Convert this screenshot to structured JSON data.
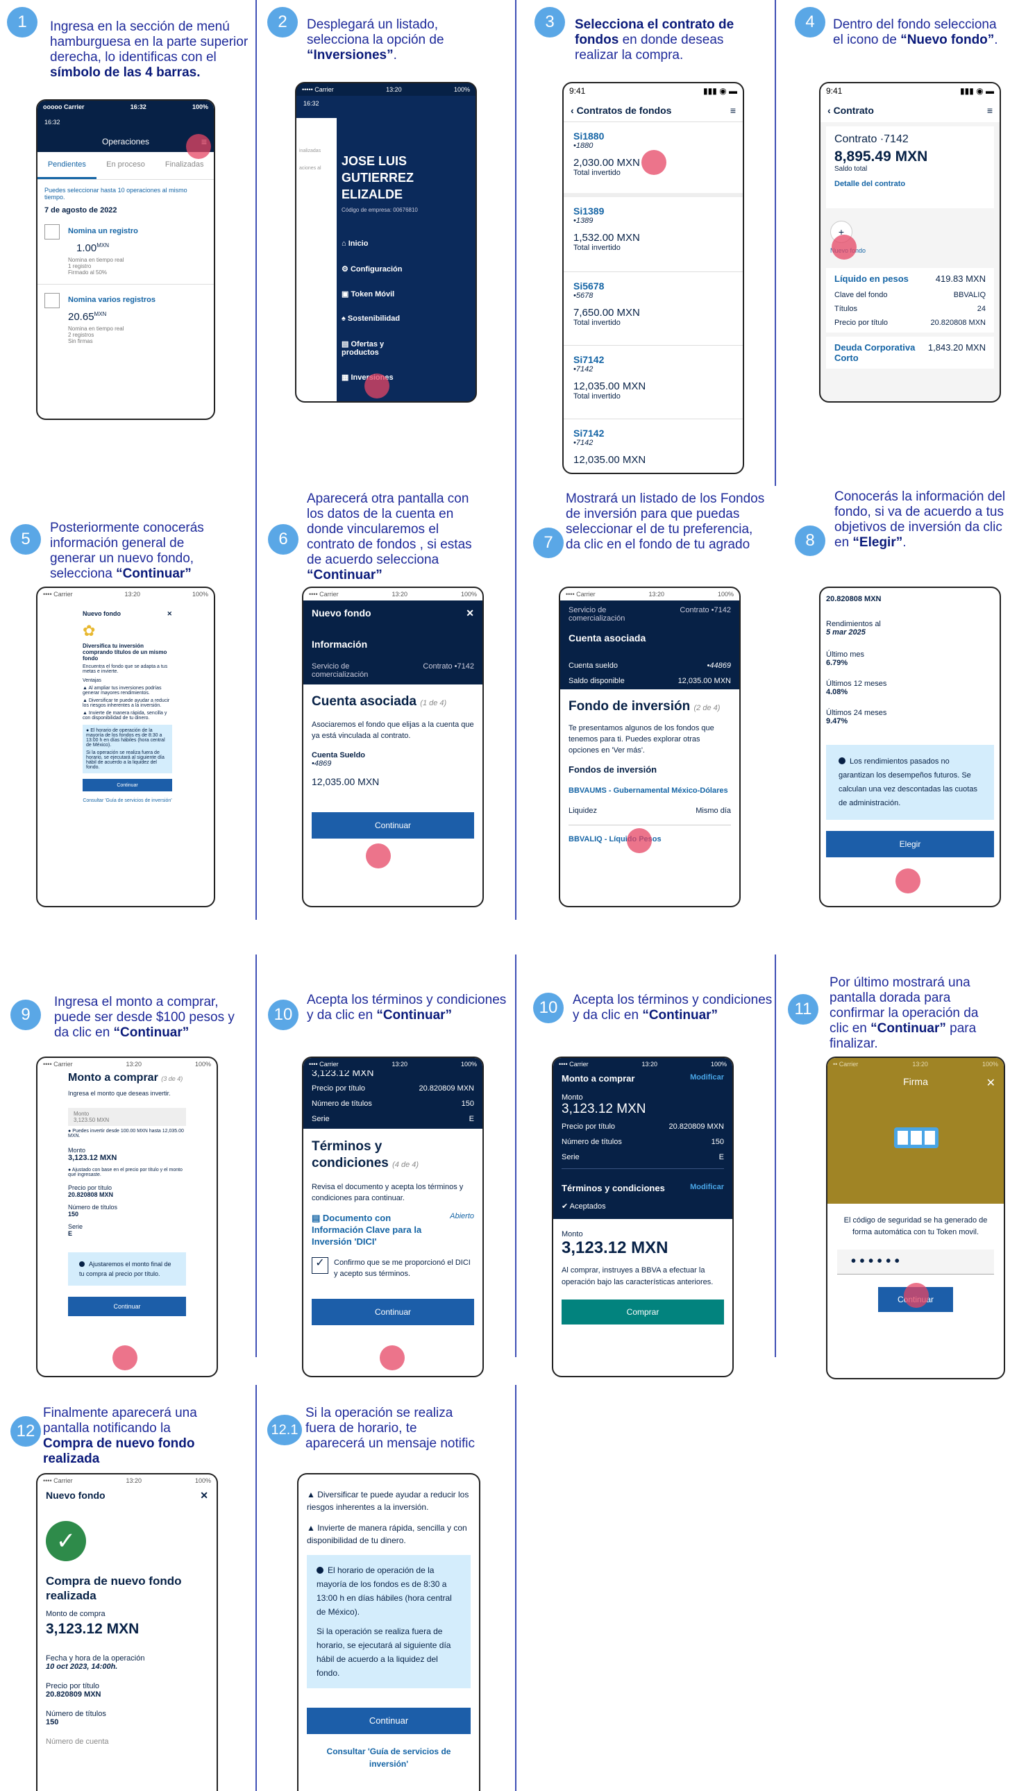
{
  "steps": {
    "s1": {
      "num": "1",
      "t1": "Ingresa en la sección de menú hamburguesa en la parte superior derecha, lo identificas con el ",
      "b1": "símbolo de las 4 barras."
    },
    "s2": {
      "num": "2",
      "t1": "Desplegará un listado, selecciona la opción de ",
      "b1": "“Inversiones”",
      "t2": "."
    },
    "s3": {
      "num": "3",
      "b1": "Selecciona el contrato de fondos",
      "t1": " en donde deseas realizar la compra."
    },
    "s4": {
      "num": "4",
      "t1": "Dentro del fondo selecciona el icono de ",
      "b1": "“Nuevo fondo”",
      "t2": "."
    },
    "s5": {
      "num": "5",
      "t1": "Posteriormente conocerás información general de generar un nuevo fondo, selecciona ",
      "b1": "“Continuar”"
    },
    "s6": {
      "num": "6",
      "t1": "Aparecerá otra pantalla con los datos de la cuenta en donde vincularemos el contrato de fondos , si estas de acuerdo selecciona ",
      "b1": "“Continuar”"
    },
    "s7": {
      "num": "7",
      "t1": "Mostrará un listado de los Fondos de inversión para que puedas seleccionar el de tu preferencia, da clic en el fondo de tu agrado"
    },
    "s8": {
      "num": "8",
      "t1": "Conocerás la información del fondo, si va de acuerdo a tus objetivos de inversión da clic en ",
      "b1": "“Elegir”",
      "t2": "."
    },
    "s9": {
      "num": "9",
      "t1": "Ingresa el monto a comprar, puede ser desde $100 pesos y da clic en ",
      "b1": "“Continuar”"
    },
    "s10a": {
      "num": "10",
      "t1": "Acepta los términos y condiciones y da clic en ",
      "b1": "“Continuar”"
    },
    "s10b": {
      "num": "10",
      "t1": "Acepta los términos y condiciones y da clic en ",
      "b1": "“Continuar”"
    },
    "s11": {
      "num": "11",
      "t1": "Por último mostrará una pantalla dorada para confirmar la operación da clic en ",
      "b1": "“Continuar”",
      "t2": " para finalizar."
    },
    "s12": {
      "num": "12",
      "t1": "Finalmente aparecerá una pantalla notificando la ",
      "b1": "Compra de nuevo fondo realizada"
    },
    "s121": {
      "num": "12.1",
      "t1": "Si la operación se realiza fuera de horario, te aparecerá un mensaje notific"
    }
  },
  "p1": {
    "status_left": "ooooo Carrier",
    "time": "16:32",
    "status_right": "100%",
    "title": "Operaciones",
    "tabs": [
      "Pendientes",
      "En proceso",
      "Finalizadas"
    ],
    "info": "Puedes seleccionar hasta 10 operaciones al mismo tiempo.",
    "date": "7 de agosto de 2022",
    "items": [
      {
        "name": "Nomina un registro",
        "amount": "1.00",
        "cur": "MXN",
        "l1": "Nomina en tiempo real",
        "l2": "1 registro",
        "l3": "Firmado al 50%"
      },
      {
        "name": "Nomina varios registros",
        "amount": "20.65",
        "cur": "MXN",
        "l1": "Nomina en tiempo real",
        "l2": "2 registros",
        "l3": "Sin firmas"
      }
    ]
  },
  "p2": {
    "time": "16:32",
    "name": "JOSE LUIS GUTIERREZ ELIZALDE",
    "code": "Código de empresa: 00676810",
    "side1": "inalizadas",
    "side2": "aciones al",
    "menu": [
      "Inicio",
      "Configuración",
      "Token Móvil",
      "Sostenibilidad",
      "Ofertas y productos",
      "Inversiones"
    ]
  },
  "p3": {
    "time": "9:41",
    "title": "Contratos de fondos",
    "items": [
      {
        "name": "Si1880",
        "code": "•1880",
        "amount": "2,030.00 MXN",
        "label": "Total invertido"
      },
      {
        "name": "Si1389",
        "code": "•1389",
        "amount": "1,532.00 MXN",
        "label": "Total invertido"
      },
      {
        "name": "Si5678",
        "code": "•5678",
        "amount": "7,650.00 MXN",
        "label": "Total invertido"
      },
      {
        "name": "Si7142",
        "code": "•7142",
        "amount": "12,035.00 MXN",
        "label": "Total invertido"
      },
      {
        "name": "Si7142",
        "code": "•7142",
        "amount": "12,035.00 MXN",
        "label": ""
      }
    ]
  },
  "p4": {
    "time": "9:41",
    "title": "Contrato",
    "contract": "Contrato ·7142",
    "total": "8,895.49 MXN",
    "total_label": "Saldo total",
    "detail": "Detalle del contrato",
    "new_fund": "Nuevo fondo",
    "fund1": "Líquido en pesos",
    "fund1_val": "419.83 MXN",
    "rows": [
      [
        "Clave del fondo",
        "BBVALIQ"
      ],
      [
        "Títulos",
        "24"
      ],
      [
        "Precio por título",
        "20.820808 MXN"
      ]
    ],
    "fund2": "Deuda Corporativa Corto",
    "fund2_val": "1,843.20 MXN"
  },
  "p5": {
    "time": "13:20",
    "title": "Nuevo fondo",
    "heading": "Diversifica tu inversión comprando títulos de un mismo fondo",
    "sub": "Encuentra el fondo que se adapta a tus metas e invierte.",
    "ventajas": "Ventajas",
    "b1": "Al ampliar tus inversiones podrías generar mayores rendimientos.",
    "b2": "Diversificar te puede ayudar a reducir los riesgos inherentes a la inversión.",
    "b3": "Invierte de manera rápida, sencilla y con disponibilidad de tu dinero.",
    "info1": "El horario de operación de la mayoría de los fondos es de 8:30 a 13:00 h en días hábiles (hora central de México).",
    "info2": "Si la operación se realiza fuera de horario, se ejecutará al siguiente día hábil de acuerdo a la liquidez del fondo.",
    "btn": "Continuar",
    "link": "Consultar 'Guía de servicios de inversión'"
  },
  "p6": {
    "time": "13:20",
    "title": "Nuevo fondo",
    "info": "Información",
    "svc": "Servicio de comercialización",
    "contract": "Contrato •7142",
    "heading": "Cuenta asociada",
    "step": "(1 de 4)",
    "desc": "Asociaremos el fondo que elijas a la cuenta que ya está vinculada al contrato.",
    "acc": "Cuenta Sueldo",
    "acc_num": "•4869",
    "amount": "12,035.00 MXN",
    "btn": "Continuar"
  },
  "p7": {
    "time": "13:20",
    "svc": "Servicio de comercialización",
    "contract": "Contrato •7142",
    "sec": "Cuenta asociada",
    "acc": "Cuenta sueldo",
    "acc_num": "•44869",
    "avail": "Saldo disponible",
    "avail_val": "12,035.00 MXN",
    "heading": "Fondo de inversión",
    "step": "(2 de 4)",
    "desc": "Te presentamos algunos de los fondos que tenemos para ti. Puedes explorar otras opciones en 'Ver más'.",
    "sub": "Fondos de inversión",
    "f1": "BBVAUMS - Gubernamental México-Dólares",
    "liq": "Liquidez",
    "liq_val": "Mismo día",
    "f2": "BBVALIQ - Líquido Pesos"
  },
  "p8": {
    "price": "20.820808 MXN",
    "rend": "Rendimientos al",
    "rend_date": "5 mar 2025",
    "r1": "Último mes",
    "r1v": "6.79%",
    "r2": "Últimos 12 meses",
    "r2v": "4.08%",
    "r3": "Últimos 24 meses",
    "r3v": "9.47%",
    "info": "Los rendimientos pasados no garantizan los desempeños futuros. Se calculan una vez descontadas las cuotas de administración.",
    "btn": "Elegir"
  },
  "p9": {
    "time": "13:20",
    "title": "Monto a comprar",
    "step": "(3 de 4)",
    "desc": "Ingresa el monto que deseas invertir.",
    "field_label": "Monto",
    "field_val": "3,123.50 MXN",
    "hint": "Puedes invertir desde 100.00 MXN hasta 12,035.00 MXN.",
    "m": "Monto",
    "mv": "3,123.12 MXN",
    "adj": "Ajustado con base en el precio por título y el monto que ingresaste.",
    "pp": "Precio por título",
    "ppv": "20.820808 MXN",
    "nt": "Número de títulos",
    "ntv": "150",
    "se": "Serie",
    "sev": "E",
    "info": "Ajustaremos el monto final de tu compra al precio por título.",
    "btn": "Continuar"
  },
  "p10a": {
    "time": "13:20",
    "top": "3,123.12 MXN",
    "pp": "Precio por título",
    "ppv": "20.820809 MXN",
    "nt": "Número de títulos",
    "ntv": "150",
    "se": "Serie",
    "sev": "E",
    "heading": "Términos y condiciones",
    "step": "(4 de 4)",
    "desc": "Revisa el documento y acepta los términos y condiciones para continuar.",
    "doc": "Documento con Información Clave para la Inversión 'DICI'",
    "doc_status": "Abierto",
    "check": "Confirmo que se me proporcionó el DICI y acepto sus términos.",
    "btn": "Continuar"
  },
  "p10b": {
    "time": "13:20",
    "sec1": "Monto a comprar",
    "mod": "Modificar",
    "m": "Monto",
    "mv": "3,123.12 MXN",
    "pp": "Precio por título",
    "ppv": "20.820809 MXN",
    "nt": "Número de títulos",
    "ntv": "150",
    "se": "Serie",
    "sev": "E",
    "sec2": "Términos y condiciones",
    "accepted": "Aceptados",
    "m2": "Monto",
    "m2v": "3,123.12 MXN",
    "desc": "Al comprar, instruyes a BBVA a efectuar la operación bajo las características anteriores.",
    "btn": "Comprar"
  },
  "p11": {
    "time": "13:20",
    "title": "Firma",
    "desc": "El código de seguridad se ha generado de forma automática con tu Token movil.",
    "dots": "• • • • • •",
    "btn": "Continuar"
  },
  "p12": {
    "time": "13:20",
    "title": "Nuevo fondo",
    "heading": "Compra de nuevo fondo realizada",
    "m": "Monto de compra",
    "mv": "3,123.12 MXN",
    "fd": "Fecha y hora de la operación",
    "fdv": "10 oct 2023, 14:00h.",
    "pp": "Precio por título",
    "ppv": "20.820809 MXN",
    "nt": "Número de títulos",
    "ntv": "150",
    "nc": "Número de cuenta"
  },
  "p121": {
    "b2": "Diversificar te puede ayudar a reducir los riesgos inherentes a la inversión.",
    "b3": "Invierte de manera rápida, sencilla y con disponibilidad de tu dinero.",
    "info1": "El horario de operación de la mayoría de los fondos es de 8:30 a 13:00 h en días hábiles (hora central de México).",
    "info2": "Si la operación se realiza fuera de horario, se ejecutará al siguiente día hábil de acuerdo a la liquidez del fondo.",
    "btn": "Continuar",
    "link": "Consultar 'Guía de servicios de inversión'"
  }
}
